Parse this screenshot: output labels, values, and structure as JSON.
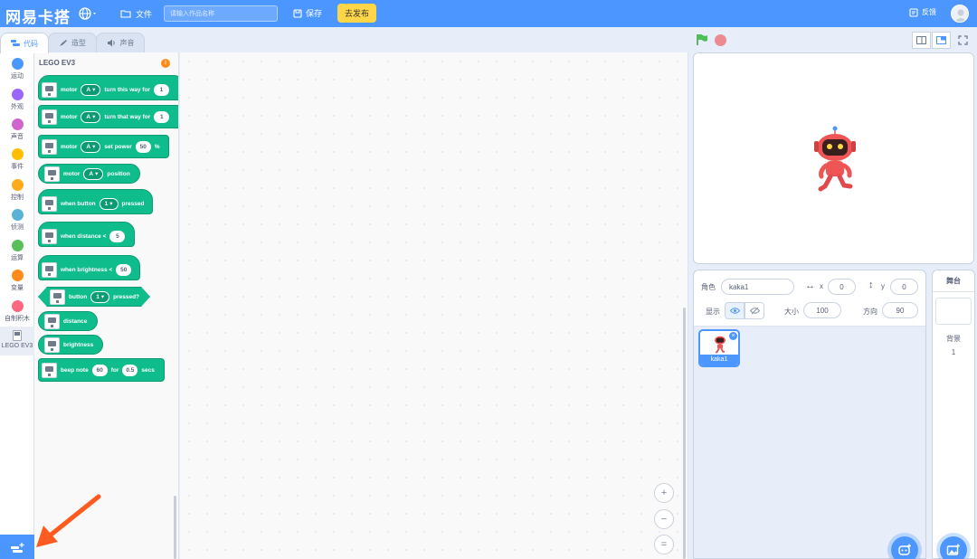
{
  "app": {
    "logo": "网易卡搭"
  },
  "topbar": {
    "file_label": "文件",
    "title_placeholder": "请输入作品名称",
    "save_label": "保存",
    "publish_label": "去发布",
    "feedback_label": "反馈"
  },
  "tabs": [
    {
      "label": "代码",
      "icon": "code-icon",
      "active": true
    },
    {
      "label": "造型",
      "icon": "brush-icon",
      "active": false
    },
    {
      "label": "声音",
      "icon": "speaker-icon",
      "active": false
    }
  ],
  "categories": [
    {
      "label": "运动",
      "color": "#4c97ff"
    },
    {
      "label": "外观",
      "color": "#9966ff"
    },
    {
      "label": "声音",
      "color": "#cf63cf"
    },
    {
      "label": "事件",
      "color": "#ffbf00"
    },
    {
      "label": "控制",
      "color": "#ffab19"
    },
    {
      "label": "侦测",
      "color": "#5cb1d6"
    },
    {
      "label": "运算",
      "color": "#59c059"
    },
    {
      "label": "变量",
      "color": "#ff8c1a"
    },
    {
      "label": "自制积木",
      "color": "#ff6680"
    },
    {
      "label": "LEGO EV3",
      "color": ""
    }
  ],
  "palette": {
    "title": "LEGO EV3",
    "badge": "!",
    "blocks": {
      "b1": {
        "t1": "motor",
        "drop": "A",
        "t2": "turn this way for",
        "num": "1"
      },
      "b2": {
        "t1": "motor",
        "drop": "A",
        "t2": "turn that way for",
        "num": "1"
      },
      "b3": {
        "t1": "motor",
        "drop": "A",
        "t2": "set power",
        "num": "50",
        "t3": "%"
      },
      "b4": {
        "t1": "motor",
        "drop": "A",
        "t2": "position"
      },
      "b5": {
        "t1": "when button",
        "drop": "1",
        "t2": "pressed"
      },
      "b6": {
        "t1": "when distance <",
        "num": "5"
      },
      "b7": {
        "t1": "when brightness <",
        "num": "50"
      },
      "b8": {
        "t1": "button",
        "drop": "1",
        "t2": "pressed?"
      },
      "b9": {
        "t1": "distance"
      },
      "b10": {
        "t1": "brightness"
      },
      "b11": {
        "t1": "beep note",
        "num": "60",
        "t2": "for",
        "num2": "0.5",
        "t3": "secs"
      }
    }
  },
  "workspace": {
    "zoom_in": "+",
    "zoom_out": "−",
    "zoom_reset": "="
  },
  "sprite": {
    "label_sprite": "角色",
    "name": "kaka1",
    "label_x": "x",
    "x": "0",
    "label_y": "y",
    "y": "0",
    "label_show": "显示",
    "label_size": "大小",
    "size": "100",
    "label_direction": "方向",
    "direction": "90",
    "card_name": "kaka1"
  },
  "stage_panel": {
    "title": "舞台",
    "backdrops_label": "背景",
    "backdrops_count": "1"
  }
}
